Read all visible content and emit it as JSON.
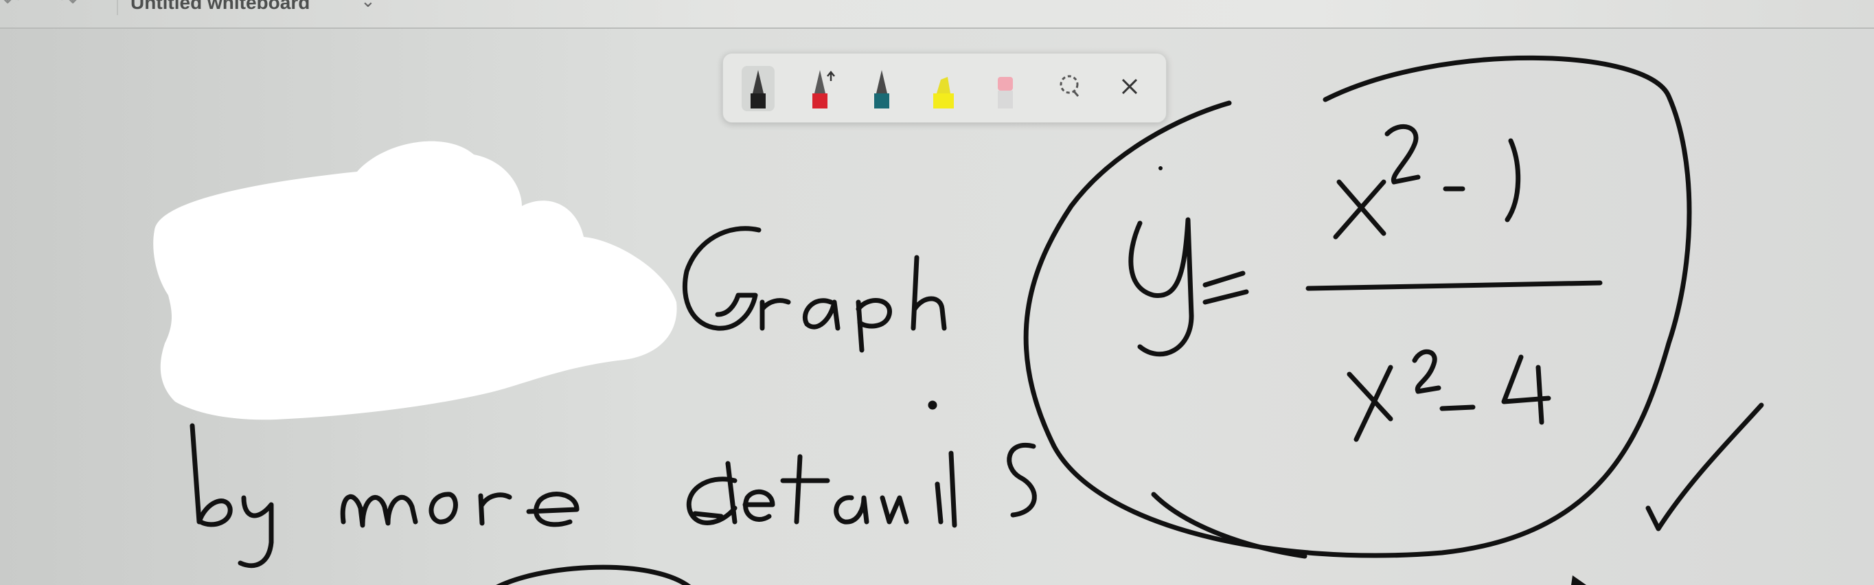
{
  "window": {
    "title": "Untitled whiteboard",
    "back_glyph": "↶",
    "forward_glyph": "↷",
    "chevron_glyph": "⌄"
  },
  "toolbar": {
    "tools": [
      {
        "name": "pen-black",
        "icon": "pen-icon",
        "color": "#1e1e1e"
      },
      {
        "name": "pen-red",
        "icon": "pen-icon",
        "color": "#d8232e"
      },
      {
        "name": "pen-teal",
        "icon": "pen-icon",
        "color": "#1a6a74"
      },
      {
        "name": "highlighter-yellow",
        "icon": "highlighter-icon",
        "color": "#f4ec1c"
      },
      {
        "name": "eraser",
        "icon": "eraser-icon",
        "color": "#f2a9b4"
      }
    ],
    "lasso_icon": "lasso-select-icon",
    "close_icon": "close-icon"
  },
  "ink_color": "#111111",
  "redaction_color": "#ffffff"
}
